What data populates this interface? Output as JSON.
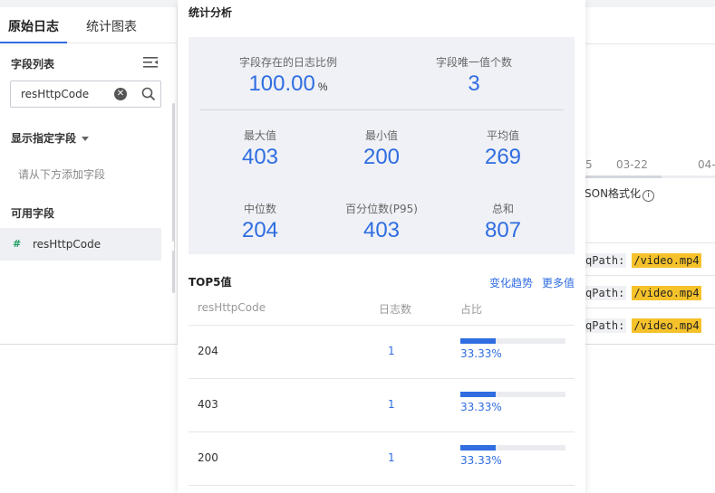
{
  "tabs": [
    {
      "label": "原始日志"
    },
    {
      "label": "统计图表"
    }
  ],
  "field_list": {
    "title": "字段列表",
    "search_value": "resHttpCode",
    "show_fields_label": "显示指定字段",
    "hint": "请从下方添加字段",
    "available_label": "可用字段",
    "items": [
      {
        "icon": "#",
        "name": "resHttpCode"
      }
    ]
  },
  "background_right": {
    "dates": [
      "5",
      "03-22",
      "04-"
    ],
    "json_label": "SON格式化",
    "rows": [
      {
        "key": "qPath:",
        "value": "/video.mp4"
      },
      {
        "key": "qPath:",
        "value": "/video.mp4"
      },
      {
        "key": "qPath:",
        "value": "/video.mp4"
      }
    ]
  },
  "popup": {
    "title": "统计分析",
    "stats": {
      "log_ratio": {
        "label": "字段存在的日志比例",
        "value": "100.00",
        "unit": "%"
      },
      "unique": {
        "label": "字段唯一值个数",
        "value": "3"
      },
      "max": {
        "label": "最大值",
        "value": "403"
      },
      "min": {
        "label": "最小值",
        "value": "200"
      },
      "avg": {
        "label": "平均值",
        "value": "269"
      },
      "median": {
        "label": "中位数",
        "value": "204"
      },
      "p95": {
        "label": "百分位数(P95)",
        "value": "403"
      },
      "sum": {
        "label": "总和",
        "value": "807"
      }
    },
    "top5": {
      "title": "TOP5值",
      "trend_link": "变化趋势",
      "more_link": "更多值",
      "columns": [
        "resHttpCode",
        "日志数",
        "占比"
      ],
      "rows": [
        {
          "value": "204",
          "count": "1",
          "pct": "33.33%",
          "fraction": 0.3333
        },
        {
          "value": "403",
          "count": "1",
          "pct": "33.33%",
          "fraction": 0.3333
        },
        {
          "value": "200",
          "count": "1",
          "pct": "33.33%",
          "fraction": 0.3333
        }
      ]
    }
  },
  "colors": {
    "accent": "#2f6de1",
    "highlight": "#f6c22b",
    "panel_bg": "#eff1f6"
  }
}
